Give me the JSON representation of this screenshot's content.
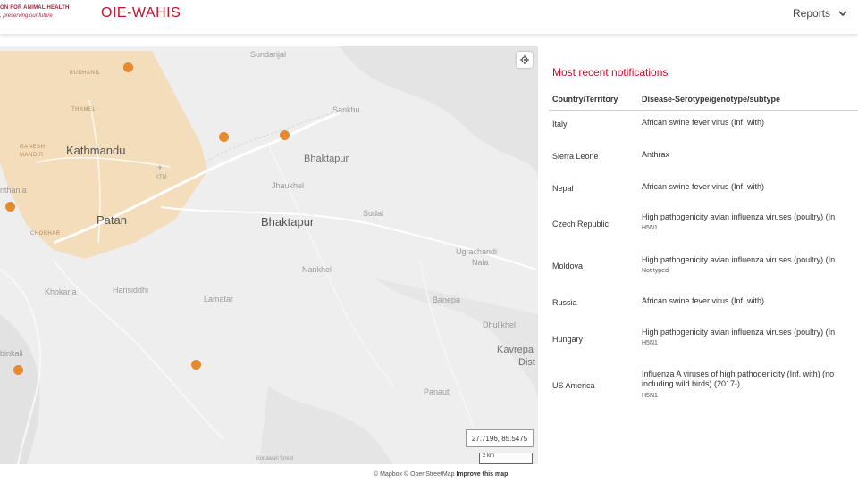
{
  "header": {
    "org_line1": "ON FOR ANIMAL HEALTH",
    "org_line2": ", preserving our future",
    "app_title": "OIE-WAHIS",
    "reports_label": "Reports"
  },
  "map": {
    "places": {
      "sundarijal": "Sundarijal",
      "sankhu": "Sankhu",
      "bhaktapur_small": "Bhaktapur",
      "jhaukhel": "Jhaukhel",
      "bhaktapur": "Bhaktapur",
      "sudal": "Sudal",
      "kathmandu": "Kathmandu",
      "patan": "Patan",
      "ktm": "KTM",
      "budhanil": "BUDHANIL",
      "thamel": "THAMEL",
      "ganesh": "GANESH",
      "mandir": "MANDIR",
      "chobhar": "CHOBHAR",
      "thankot": "nthania",
      "khokana": "Khokana",
      "harisiddhi": "Harisiddhi",
      "lamatar": "Lamatar",
      "nankhel": "Nankhel",
      "ugrachandi1": "Ugrachandi",
      "ugrachandi2": "Nala",
      "banepa": "Banepa",
      "dhulikhel": "Dhulikhel",
      "kavrepa1": "Kavrepa",
      "kavrepa2": "Dist",
      "panauti": "Panauti",
      "bhinkali": "binkali",
      "godavari": "Godawari forest"
    },
    "coordinates": "27.7196, 85.5475",
    "scale_label": "2 km",
    "attribution_mapbox": "© Mapbox",
    "attribution_osm": "© OpenStreetMap",
    "attribution_improve": "Improve this map",
    "colors": {
      "region": "#f5d9b0",
      "marker": "#e58a2e",
      "river": "#ffffff"
    }
  },
  "notifications": {
    "title": "Most recent notifications",
    "columns": {
      "country": "Country/Territory",
      "disease": "Disease-Serotype/genotype/subtype"
    },
    "rows": [
      {
        "country": "Italy",
        "disease": "African swine fever virus (Inf. with)",
        "sub": ""
      },
      {
        "country": "Sierra Leone",
        "disease": "Anthrax",
        "sub": ""
      },
      {
        "country": "Nepal",
        "disease": "African swine fever virus (Inf. with)",
        "sub": ""
      },
      {
        "country": "Czech Republic",
        "disease": "High pathogenicity avian influenza viruses (poultry) (In",
        "sub": "H5N1"
      },
      {
        "country": "Moldova",
        "disease": "High pathogenicity avian influenza viruses (poultry) (In",
        "sub": "Not typed"
      },
      {
        "country": "Russia",
        "disease": "African swine fever virus (Inf. with)",
        "sub": ""
      },
      {
        "country": "Hungary",
        "disease": "High pathogenicity avian influenza viruses (poultry) (In",
        "sub": "H5N1"
      },
      {
        "country": "US America",
        "disease": "Influenza A viruses of high pathogenicity (Inf. with) (no including wild birds) (2017-)",
        "sub": "H5N1"
      }
    ]
  }
}
